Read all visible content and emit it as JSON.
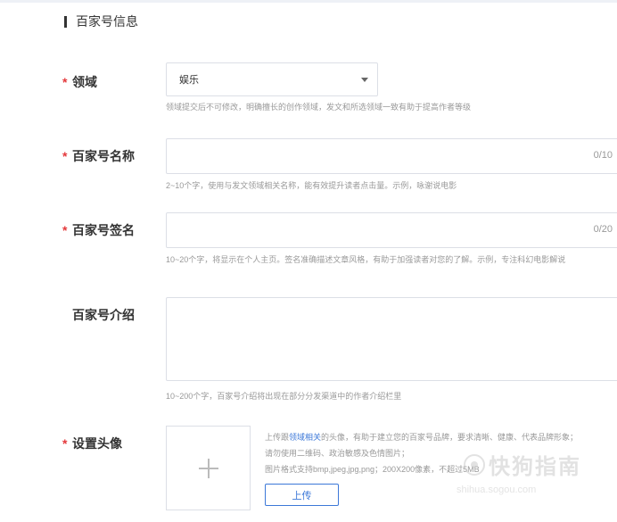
{
  "section": {
    "title": "百家号信息"
  },
  "domain_field": {
    "label": "领域",
    "value": "娱乐",
    "hint": "领域提交后不可修改，明确擅长的创作领域，发文和所选领域一致有助于提高作者等级"
  },
  "name_field": {
    "label": "百家号名称",
    "count": "0/10",
    "hint": "2~10个字，使用与发文领域相关名称，能有效提升读者点击量。示例，咏谢说电影"
  },
  "signature_field": {
    "label": "百家号签名",
    "count": "0/20",
    "hint": "10~20个字，将显示在个人主页。签名准确描述文章风格，有助于加强读者对您的了解。示例，专注科幻电影解说"
  },
  "intro_field": {
    "label": "百家号介绍",
    "hint": "10~200个字，百家号介绍将出现在部分分发渠道中的作者介绍栏里"
  },
  "avatar_field": {
    "label": "设置头像",
    "desc_line1_prefix": "上传跟",
    "desc_line1_link": "领域相关",
    "desc_line1_suffix": "的头像，有助于建立您的百家号品牌，要求清晰、健康、代表品牌形象；",
    "desc_line2": "请勿使用二维码、政治敏感及色情图片；",
    "desc_line3": "图片格式支持bmp,jpeg,jpg,png；200X200像素，不超过5MB",
    "upload_label": "上传"
  },
  "watermark": {
    "text": "快狗指南",
    "url": "shihua.sogou.com"
  },
  "colors": {
    "required": "#e4393c",
    "accent": "#3c78d8",
    "border": "#dcdfe6"
  }
}
